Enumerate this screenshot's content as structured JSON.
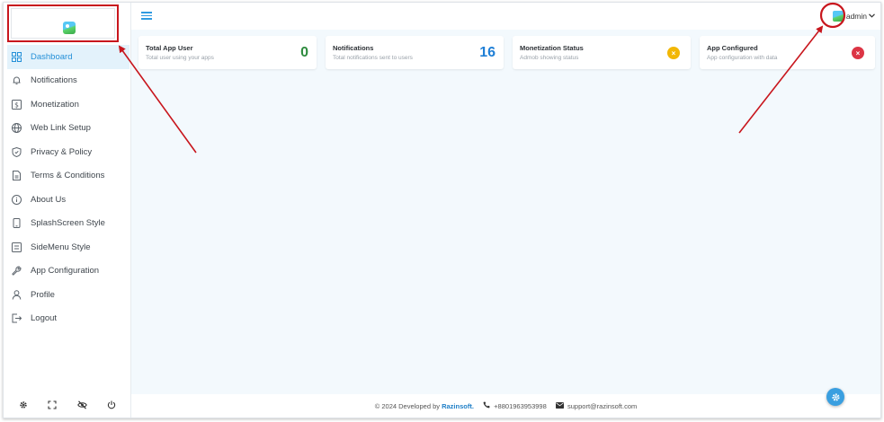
{
  "sidebar": {
    "items": [
      {
        "label": "Dashboard",
        "icon": "dashboard-icon",
        "active": true
      },
      {
        "label": "Notifications",
        "icon": "bell-icon"
      },
      {
        "label": "Monetization",
        "icon": "dollar-icon"
      },
      {
        "label": "Web Link Setup",
        "icon": "globe-icon"
      },
      {
        "label": "Privacy & Policy",
        "icon": "shield-icon"
      },
      {
        "label": "Terms & Conditions",
        "icon": "document-icon"
      },
      {
        "label": "About Us",
        "icon": "info-icon"
      },
      {
        "label": "SplashScreen Style",
        "icon": "phone-icon"
      },
      {
        "label": "SideMenu Style",
        "icon": "list-icon"
      },
      {
        "label": "App Configuration",
        "icon": "wrench-icon"
      },
      {
        "label": "Profile",
        "icon": "user-icon"
      },
      {
        "label": "Logout",
        "icon": "logout-icon"
      }
    ],
    "bottom_icons": [
      "gear-icon",
      "fullscreen-icon",
      "eye-off-icon",
      "power-icon"
    ]
  },
  "header": {
    "user_name": "admin"
  },
  "cards": [
    {
      "title": "Total App User",
      "subtitle": "Total user using your apps",
      "value": "0",
      "value_color": "#2e8b3e"
    },
    {
      "title": "Notifications",
      "subtitle": "Total notifications sent to users",
      "value": "16",
      "value_color": "#1f7fd6"
    },
    {
      "title": "Monetization Status",
      "subtitle": "Admob showing status",
      "badge": "×",
      "badge_color": "#f2b705"
    },
    {
      "title": "App Configured",
      "subtitle": "App configuration with data",
      "badge": "×",
      "badge_color": "#dc3545"
    }
  ],
  "footer": {
    "copyright": "© 2024 Developed by",
    "brand": "Razinsoft.",
    "phone": "+8801963953998",
    "email": "support@razinsoft.com"
  },
  "colors": {
    "accent": "#2490d8",
    "annotation": "#c8161d"
  }
}
